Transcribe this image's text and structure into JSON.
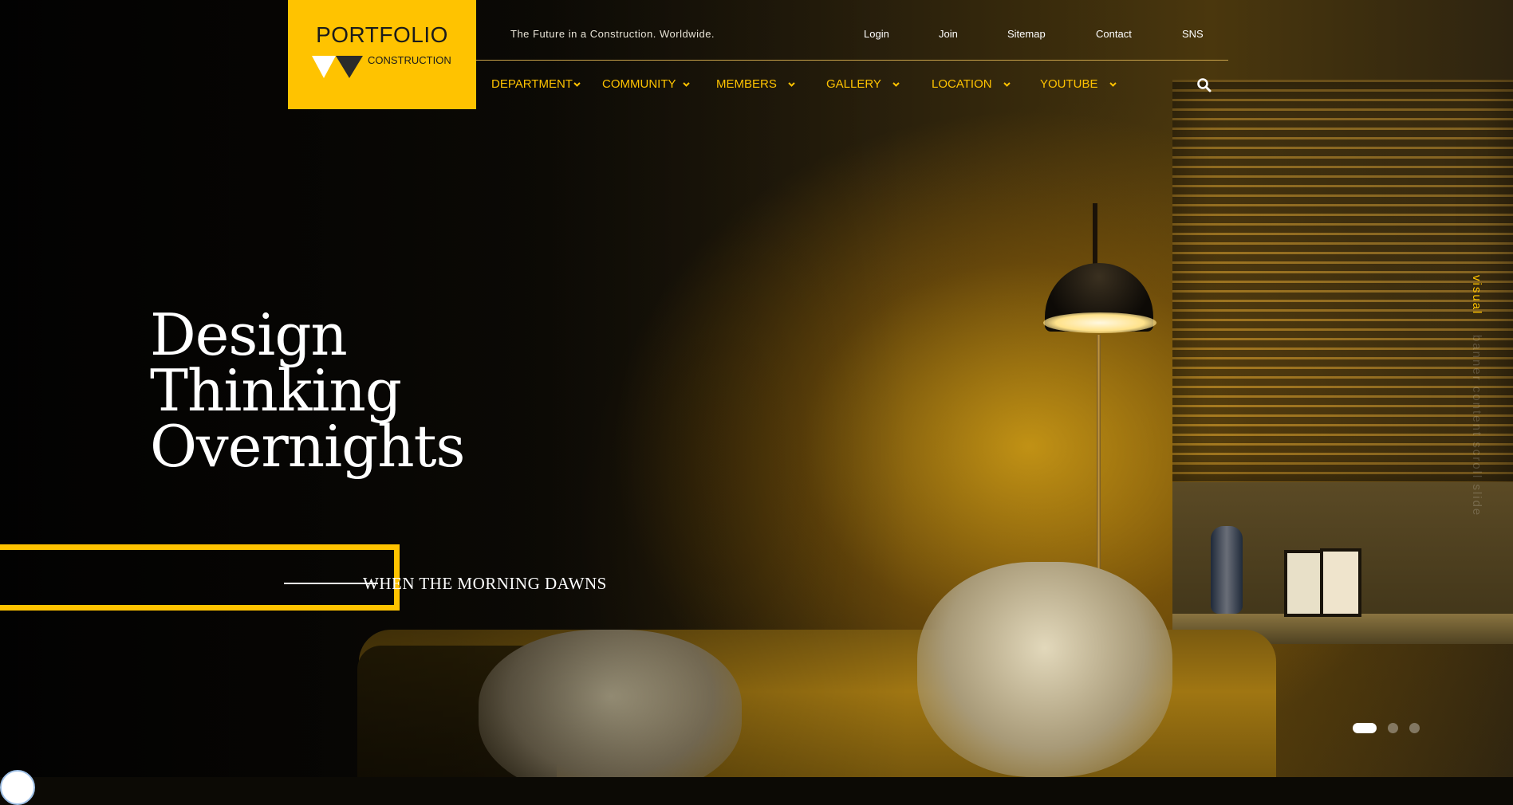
{
  "logo": {
    "title": "PORTFOLIO",
    "subtitle": "CONSTRUCTION"
  },
  "header": {
    "tagline": "The Future in a Construction. Worldwide.",
    "util_links": [
      "Login",
      "Join",
      "Sitemap",
      "Contact",
      "SNS"
    ]
  },
  "nav": {
    "items": [
      "DEPARTMENT",
      "COMMUNITY",
      "MEMBERS",
      "GALLERY",
      "LOCATION",
      "YOUTUBE"
    ],
    "search_icon": "search-icon"
  },
  "hero": {
    "headline": [
      "Design",
      "Thinking",
      "Overnights"
    ],
    "cta_text": "WHEN THE MORNING DAWNS",
    "vertical_caption": {
      "highlight": "visual",
      "rest": "banner content scroll slide"
    },
    "slider": {
      "total": 3,
      "active": 1
    }
  },
  "colors": {
    "accent": "#ffc300",
    "text": "#ffffff",
    "line": "#c8a24a"
  }
}
